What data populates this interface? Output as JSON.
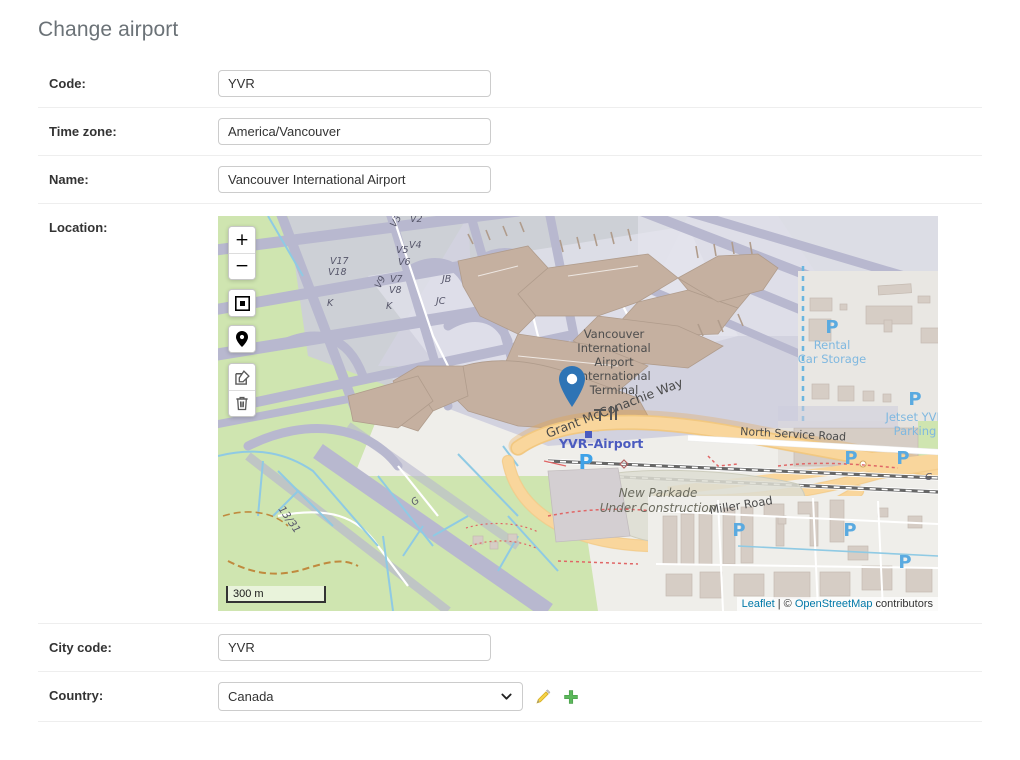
{
  "page": {
    "title": "Change airport"
  },
  "form": {
    "rows": [
      {
        "label": "Code:",
        "value": "YVR",
        "type": "text"
      },
      {
        "label": "Time zone:",
        "value": "America/Vancouver",
        "type": "text"
      },
      {
        "label": "Name:",
        "value": "Vancouver International Airport",
        "type": "text"
      },
      {
        "label": "Location:",
        "value": "",
        "type": "map"
      },
      {
        "label": "City code:",
        "value": "YVR",
        "type": "text"
      },
      {
        "label": "Country:",
        "value": "Canada",
        "type": "select"
      }
    ],
    "country": {
      "selected": "Canada",
      "edit_title": "Change selected country",
      "add_title": "Add another country"
    }
  },
  "map": {
    "controls": [
      {
        "name": "zoom-in",
        "glyph": "+"
      },
      {
        "name": "zoom-out",
        "glyph": "−"
      },
      {
        "name": "draw-rectangle",
        "glyph": "rect"
      },
      {
        "name": "draw-marker",
        "glyph": "pin"
      },
      {
        "name": "edit-layers",
        "glyph": "pencil"
      },
      {
        "name": "delete-layers",
        "glyph": "trash"
      }
    ],
    "scale": "300 m",
    "attribution": {
      "leaflet": "Leaflet",
      "separator": " | ",
      "copyright": "© ",
      "osm": "OpenStreetMap",
      "suffix": " contributors"
    },
    "labels": {
      "terminal": "Vancouver\nInternational\nAirport\nInternational\nTerminal",
      "terminal_lines": [
        "Vancouver",
        "International",
        "Airport",
        "International",
        "Terminal"
      ],
      "road_grant": "Grant McConachie Way",
      "station_yvr": "YVR–Airport",
      "parkade_lines": [
        "New Parkade",
        "Under Construction"
      ],
      "north_service_road": "North Service Road",
      "miller_road": "Miller Road",
      "rental_car_lines": [
        "Rental",
        "Car Storage"
      ],
      "jetset_lines": [
        "Jetset YVR",
        "Parking"
      ],
      "runway": "13/31",
      "taxiways": [
        "V2",
        "V3",
        "V4",
        "V5",
        "V6",
        "V7",
        "V8",
        "V9",
        "V17",
        "V18",
        "K",
        "K",
        "JB",
        "JC",
        "G",
        "G"
      ]
    },
    "colors": {
      "grass": "#cfe5b0",
      "apron": "#ccccdd",
      "terminal_building": "#c5b0a0",
      "building": "#d6cdc5",
      "road_major": "#f8cf8d",
      "water": "#a6d4e8",
      "parking_blue": "#5aaae0",
      "station_blue": "#4a5fc1",
      "marker_blue": "#2e74b5",
      "ground": "#efeeea"
    }
  }
}
